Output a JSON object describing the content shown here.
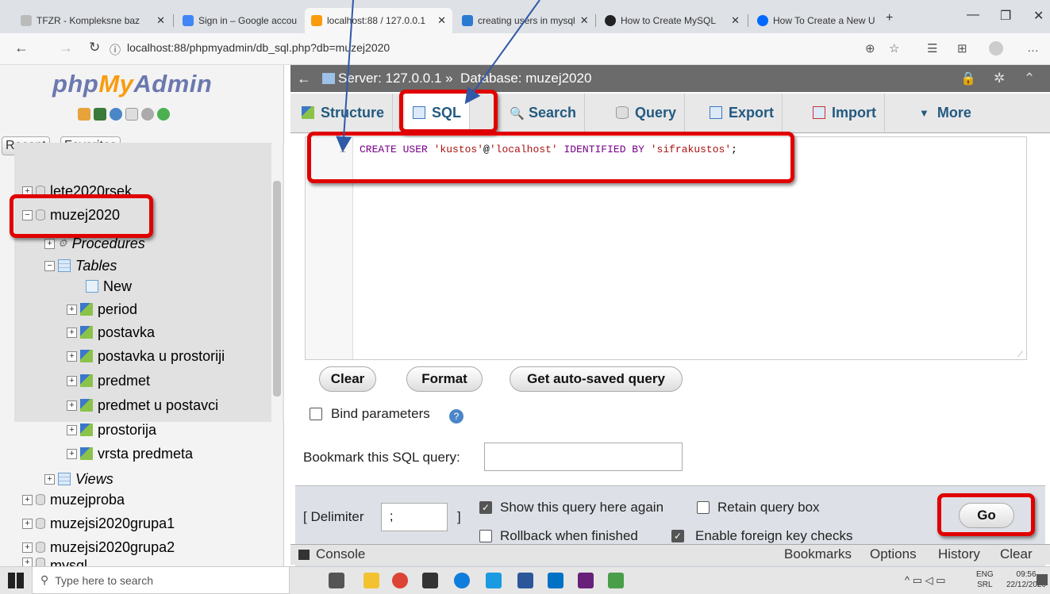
{
  "browser": {
    "tabs": [
      {
        "label": "TFZR - Kompleksne baz",
        "active": false
      },
      {
        "label": "Sign in – Google accou",
        "active": false
      },
      {
        "label": "localhost:88 / 127.0.0.1",
        "active": true
      },
      {
        "label": "creating users in mysql",
        "active": false
      },
      {
        "label": "How to Create MySQL",
        "active": false
      },
      {
        "label": "How To Create a New U",
        "active": false
      }
    ],
    "url": "localhost:88/phpmyadmin/db_sql.php?db=muzej2020"
  },
  "nav": {
    "logo_php": "php",
    "logo_my": "My",
    "logo_admin": "Admin",
    "recent": "Recent",
    "favorites": "Favorites",
    "databases": [
      "lete2020rsek",
      "muzej2020",
      "muzejproba",
      "muzejsi2020grupa1",
      "muzejsi2020grupa2",
      "mysql"
    ],
    "procedures": "Procedures",
    "tables_label": "Tables",
    "new_label": "New",
    "tables": [
      "period",
      "postavka",
      "postavka u prostoriji",
      "predmet",
      "predmet u postavci",
      "prostorija",
      "vrsta predmeta"
    ],
    "views": "Views"
  },
  "main": {
    "breadcrumb": "Server: 127.0.0.1 »  Database: muzej2020",
    "tabs": [
      "Structure",
      "SQL",
      "Search",
      "Query",
      "Export",
      "Import",
      "More"
    ],
    "line_number": "1",
    "sql_kw1": "CREATE USER ",
    "sql_user": "'kustos'",
    "sql_at": "@",
    "sql_host": "'localhost'",
    "sql_kw2": " IDENTIFIED BY ",
    "sql_pass": "'sifrakustos'",
    "sql_end": ";",
    "buttons": {
      "clear": "Clear",
      "format": "Format",
      "autosaved": "Get auto-saved query",
      "go": "Go"
    },
    "bind_params": "Bind parameters",
    "bookmark_label": "Bookmark this SQL query:",
    "delimiter_label": "[ Delimiter",
    "delimiter_value": ";",
    "delimiter_close": "]",
    "show_query": "Show this query here again",
    "retain_box": "Retain query box",
    "rollback": "Rollback when finished",
    "foreign_keys": "Enable foreign key checks"
  },
  "console": {
    "label": "Console",
    "links": [
      "Bookmarks",
      "Options",
      "History",
      "Clear"
    ]
  },
  "taskbar": {
    "search_placeholder": "Type here to search",
    "lang": "ENG",
    "region": "SRL",
    "time": "09:56",
    "date": "22/12/2020"
  }
}
